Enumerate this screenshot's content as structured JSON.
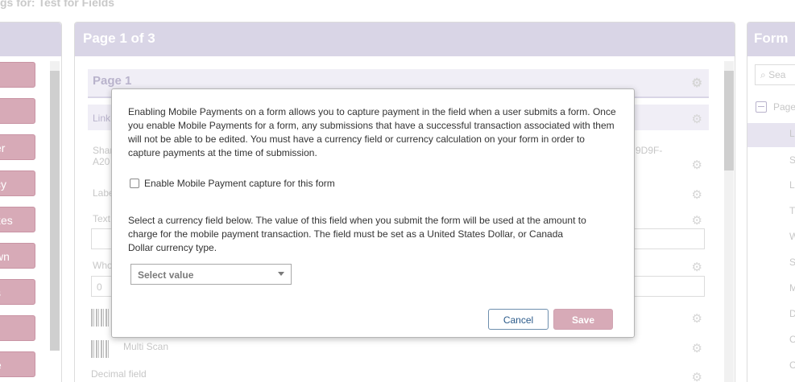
{
  "window": {
    "title_fragment": "gs for: Test for Fields"
  },
  "palette": {
    "buttons": [
      "",
      "",
      "er",
      "cy",
      "xes",
      "wn",
      "s",
      "",
      "e"
    ],
    "colors": {
      "button_bg": "#d7aab7"
    }
  },
  "page_panel": {
    "title": "Page 1 of 3",
    "subheader": "Page 1",
    "rows": {
      "link": "Link",
      "shared": "Shar",
      "shared_2": "A20",
      "shared_right": "9D9F-",
      "label": "Labe",
      "text": "Text",
      "whole": "Who",
      "whole_value": "0",
      "multi_scan": "Multi Scan",
      "decimal": "Decimal field"
    }
  },
  "form_panel": {
    "title": "Form",
    "search_placeholder": "Sea",
    "tree_root": "Page",
    "tree_items": [
      "L",
      "S",
      "L",
      "T",
      "W",
      "S",
      "M",
      "D",
      "C",
      "C"
    ]
  },
  "modal": {
    "intro": "Enabling Mobile Payments on a form allows you to capture payment in the field when a user submits a form. Once you enable Mobile Payments for a form, any submissions that have a successful transaction associated with them will not be able to be edited. You must have a currency field or currency calculation on your form in order to capture payments at the time of submission.",
    "checkbox_label": "Enable Mobile Payment capture for this form",
    "checkbox_checked": false,
    "currency_text": "Select a currency field below. The value of this field when you submit the form will be used at the amount to charge for the mobile payment transaction. The field must be set as a United States Dollar, or Canada Dollar currency type.",
    "select_value": "Select value",
    "cancel_label": "Cancel",
    "save_label": "Save",
    "colors": {
      "save_bg": "#d7aab7",
      "cancel_text": "#2a5a8a"
    }
  }
}
